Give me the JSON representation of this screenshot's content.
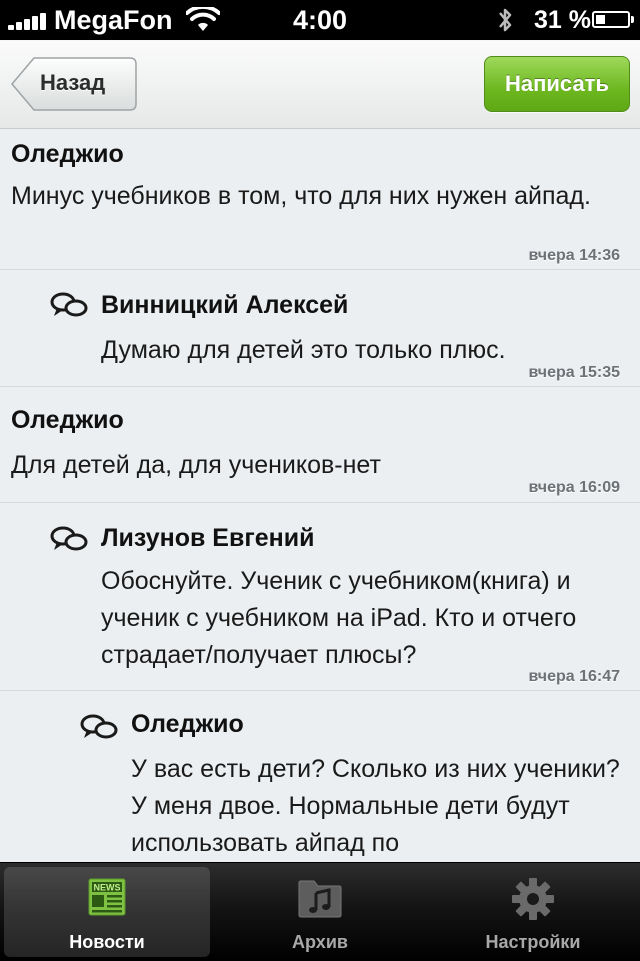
{
  "status_bar": {
    "carrier": "MegaFon",
    "time": "4:00",
    "battery": "31 %",
    "battery_level": 0.31
  },
  "nav": {
    "back_label": "Назад",
    "compose_label": "Написать"
  },
  "comments": [
    {
      "author": "Оледжио",
      "text": "Минус учебников в том, что для них нужен айпад.",
      "time": "вчера 14:36",
      "reply": false
    },
    {
      "author": "Винницкий Алексей",
      "text": "Думаю для детей это только плюс.",
      "time": "вчера 15:35",
      "reply": true
    },
    {
      "author": "Оледжио",
      "text": "Для детей да, для учеников-нет",
      "time": "вчера 16:09",
      "reply": false
    },
    {
      "author": "Лизунов Евгений",
      "text": "Обоснуйте. Ученик с учебником(книга) и ученик с учебником на iPad. Кто и отчего страдает/получает плюсы?",
      "time": "вчера 16:47",
      "reply": true
    },
    {
      "author": "Оледжио",
      "text": "У вас есть дети? Сколько из них ученики?  У меня двое. Нормальные дети будут использовать айпад по",
      "time": "",
      "reply": true
    }
  ],
  "tabs": [
    {
      "label": "Новости",
      "icon": "news-icon",
      "active": true
    },
    {
      "label": "Архив",
      "icon": "music-folder-icon",
      "active": false
    },
    {
      "label": "Настройки",
      "icon": "gear-icon",
      "active": false
    }
  ],
  "colors": {
    "accent_green": "#6db720",
    "background": "#eceff1",
    "tab_active": "#ffffff"
  }
}
